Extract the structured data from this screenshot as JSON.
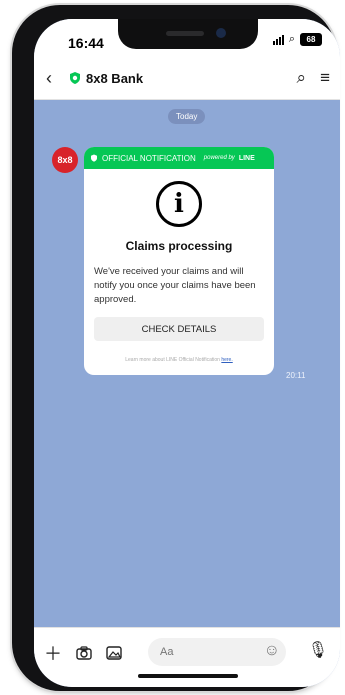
{
  "status": {
    "time": "16:44",
    "battery": "68"
  },
  "nav": {
    "title": "8x8 Bank",
    "back_icon": "chevron-left-icon",
    "search_icon": "search-icon",
    "menu_icon": "menu-icon"
  },
  "chat": {
    "date_pill": "Today",
    "avatar_text": "8x8",
    "message_time": "20:11",
    "card": {
      "header": "OFFICIAL NOTIFICATION",
      "powered": "powered by",
      "brand": "LINE",
      "icon": "info-icon",
      "heading": "Claims processing",
      "body": "We've received your claims and will notify you once your claims have been approved.",
      "button": "CHECK DETAILS",
      "learn": "Learn more about LINE Official Notification",
      "learn_link": "here."
    }
  },
  "composer": {
    "placeholder": "Aa"
  },
  "colors": {
    "chat_bg": "#8ea8d6",
    "line_green": "#06c755",
    "avatar_red": "#d8232a"
  }
}
